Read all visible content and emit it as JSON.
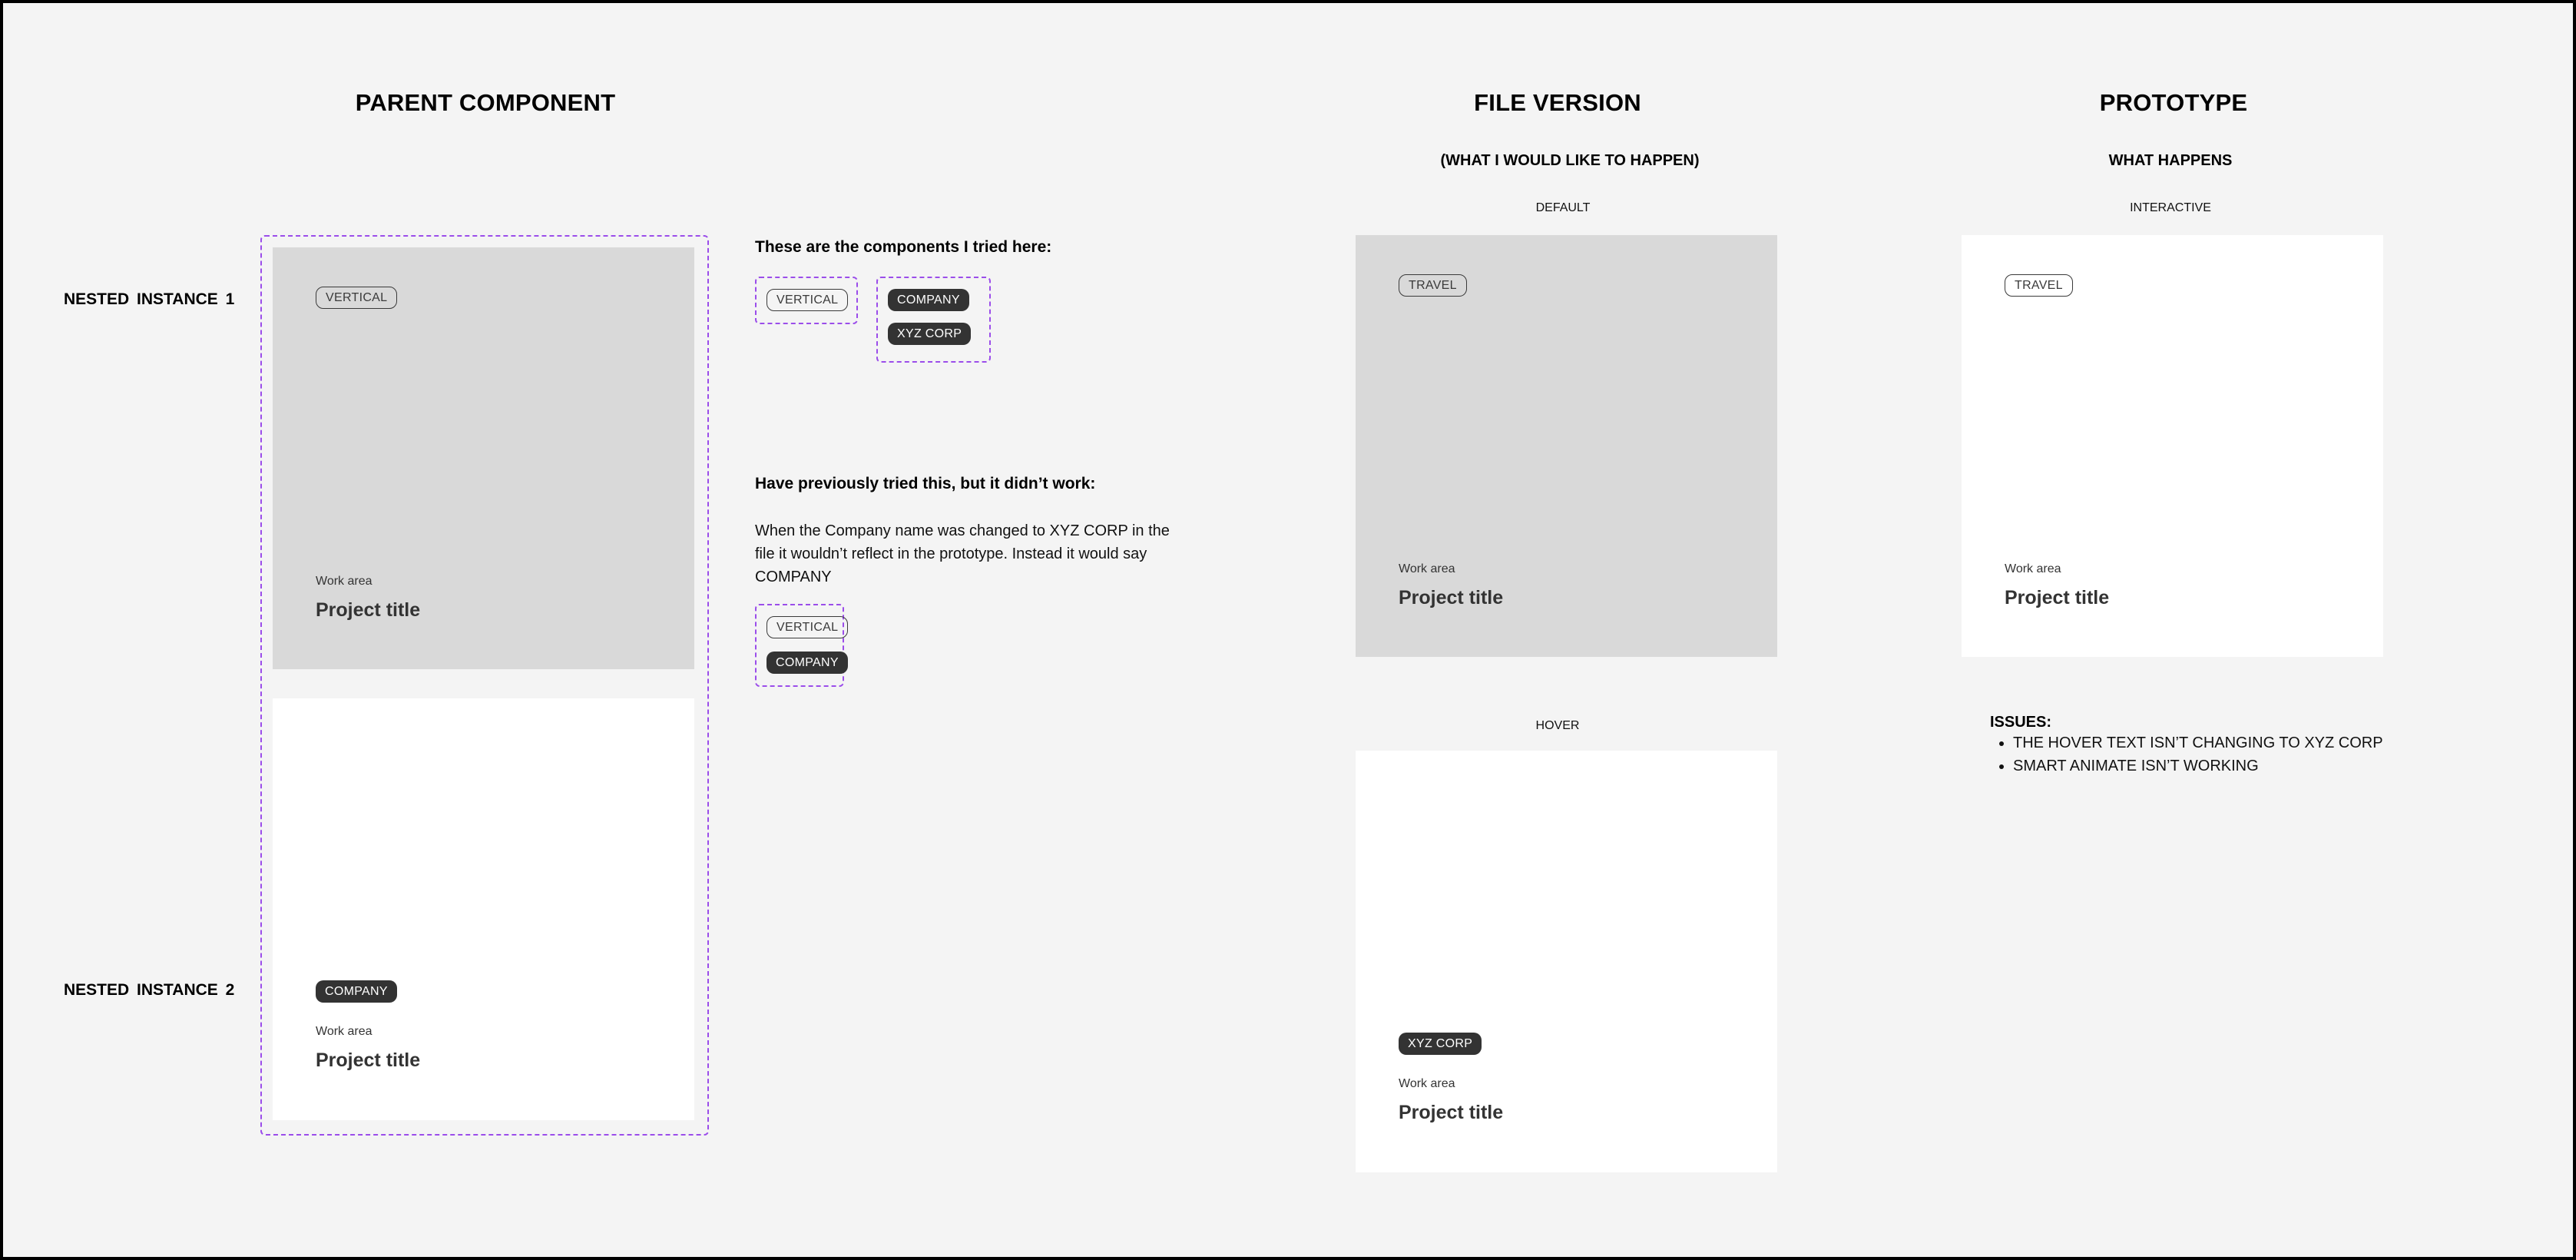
{
  "columns": {
    "parent": {
      "title": "PARENT COMPONENT"
    },
    "file_version": {
      "title": "FILE VERSION",
      "subtitle": "(WHAT I WOULD LIKE TO HAPPEN)",
      "states": [
        "DEFAULT",
        "HOVER"
      ]
    },
    "prototype": {
      "title": "PROTOTYPE",
      "subtitle": "WHAT HAPPENS",
      "states": [
        "INTERACTIVE"
      ]
    }
  },
  "row_labels": [
    "NESTED  INSTANCE 1",
    "NESTED  INSTANCE 2"
  ],
  "parent_cards": [
    {
      "chip": "VERTICAL",
      "chip_style": "outline",
      "work_area": "Work area",
      "project_title": "Project title",
      "background": "#d9d9d9"
    },
    {
      "chip": "COMPANY",
      "chip_style": "filled",
      "work_area": "Work area",
      "project_title": "Project title",
      "background": "#ffffff"
    }
  ],
  "notes": {
    "tried_heading": "These are the components I tried here:",
    "tried_components": {
      "group1": [
        "VERTICAL"
      ],
      "group2": [
        "COMPANY",
        "XYZ CORP"
      ]
    },
    "previous_heading": "Have previously tried this, but it didn’t work:",
    "previous_paragraph": "When the Company name was changed to XYZ CORP in the file it wouldn’t reflect in the prototype. Instead it would say COMPANY",
    "previous_components": [
      "VERTICAL",
      "COMPANY"
    ]
  },
  "file_cards": [
    {
      "state": "DEFAULT",
      "chip": "TRAVEL",
      "chip_style": "outline",
      "work_area": "Work area",
      "project_title": "Project title",
      "background": "#d9d9d9"
    },
    {
      "state": "HOVER",
      "chip": "XYZ CORP",
      "chip_style": "filled",
      "work_area": "Work area",
      "project_title": "Project title",
      "background": "#ffffff"
    }
  ],
  "prototype_card": {
    "state": "INTERACTIVE",
    "chip": "TRAVEL",
    "chip_style": "outline",
    "work_area": "Work area",
    "project_title": "Project title",
    "background": "#ffffff"
  },
  "issues": {
    "heading": "ISSUES:",
    "items": [
      "THE HOVER TEXT ISN’T CHANGING TO XYZ CORP",
      "SMART ANIMATE ISN’T WORKING"
    ]
  },
  "colors": {
    "canvas": "#f4f4f4",
    "frame_border": "#000000",
    "dashed_outline": "#9b4dea",
    "chip_filled": "#333333",
    "card_gray": "#d9d9d9",
    "card_white": "#ffffff"
  }
}
